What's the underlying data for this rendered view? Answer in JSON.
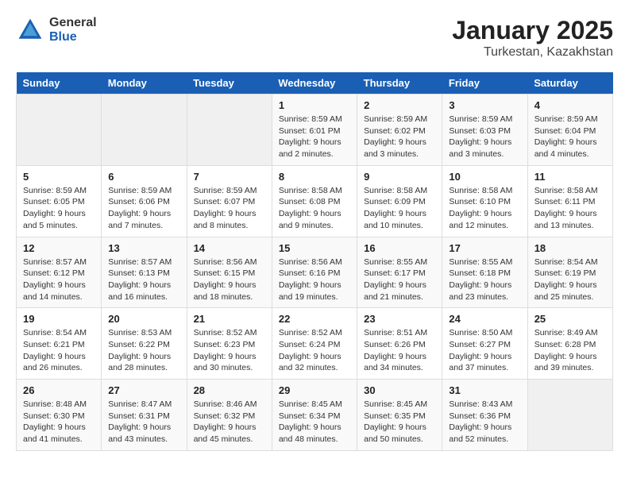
{
  "logo": {
    "general": "General",
    "blue": "Blue"
  },
  "title": "January 2025",
  "subtitle": "Turkestan, Kazakhstan",
  "days_of_week": [
    "Sunday",
    "Monday",
    "Tuesday",
    "Wednesday",
    "Thursday",
    "Friday",
    "Saturday"
  ],
  "weeks": [
    [
      {
        "day": "",
        "info": ""
      },
      {
        "day": "",
        "info": ""
      },
      {
        "day": "",
        "info": ""
      },
      {
        "day": "1",
        "info": "Sunrise: 8:59 AM\nSunset: 6:01 PM\nDaylight: 9 hours\nand 2 minutes."
      },
      {
        "day": "2",
        "info": "Sunrise: 8:59 AM\nSunset: 6:02 PM\nDaylight: 9 hours\nand 3 minutes."
      },
      {
        "day": "3",
        "info": "Sunrise: 8:59 AM\nSunset: 6:03 PM\nDaylight: 9 hours\nand 3 minutes."
      },
      {
        "day": "4",
        "info": "Sunrise: 8:59 AM\nSunset: 6:04 PM\nDaylight: 9 hours\nand 4 minutes."
      }
    ],
    [
      {
        "day": "5",
        "info": "Sunrise: 8:59 AM\nSunset: 6:05 PM\nDaylight: 9 hours\nand 5 minutes."
      },
      {
        "day": "6",
        "info": "Sunrise: 8:59 AM\nSunset: 6:06 PM\nDaylight: 9 hours\nand 7 minutes."
      },
      {
        "day": "7",
        "info": "Sunrise: 8:59 AM\nSunset: 6:07 PM\nDaylight: 9 hours\nand 8 minutes."
      },
      {
        "day": "8",
        "info": "Sunrise: 8:58 AM\nSunset: 6:08 PM\nDaylight: 9 hours\nand 9 minutes."
      },
      {
        "day": "9",
        "info": "Sunrise: 8:58 AM\nSunset: 6:09 PM\nDaylight: 9 hours\nand 10 minutes."
      },
      {
        "day": "10",
        "info": "Sunrise: 8:58 AM\nSunset: 6:10 PM\nDaylight: 9 hours\nand 12 minutes."
      },
      {
        "day": "11",
        "info": "Sunrise: 8:58 AM\nSunset: 6:11 PM\nDaylight: 9 hours\nand 13 minutes."
      }
    ],
    [
      {
        "day": "12",
        "info": "Sunrise: 8:57 AM\nSunset: 6:12 PM\nDaylight: 9 hours\nand 14 minutes."
      },
      {
        "day": "13",
        "info": "Sunrise: 8:57 AM\nSunset: 6:13 PM\nDaylight: 9 hours\nand 16 minutes."
      },
      {
        "day": "14",
        "info": "Sunrise: 8:56 AM\nSunset: 6:15 PM\nDaylight: 9 hours\nand 18 minutes."
      },
      {
        "day": "15",
        "info": "Sunrise: 8:56 AM\nSunset: 6:16 PM\nDaylight: 9 hours\nand 19 minutes."
      },
      {
        "day": "16",
        "info": "Sunrise: 8:55 AM\nSunset: 6:17 PM\nDaylight: 9 hours\nand 21 minutes."
      },
      {
        "day": "17",
        "info": "Sunrise: 8:55 AM\nSunset: 6:18 PM\nDaylight: 9 hours\nand 23 minutes."
      },
      {
        "day": "18",
        "info": "Sunrise: 8:54 AM\nSunset: 6:19 PM\nDaylight: 9 hours\nand 25 minutes."
      }
    ],
    [
      {
        "day": "19",
        "info": "Sunrise: 8:54 AM\nSunset: 6:21 PM\nDaylight: 9 hours\nand 26 minutes."
      },
      {
        "day": "20",
        "info": "Sunrise: 8:53 AM\nSunset: 6:22 PM\nDaylight: 9 hours\nand 28 minutes."
      },
      {
        "day": "21",
        "info": "Sunrise: 8:52 AM\nSunset: 6:23 PM\nDaylight: 9 hours\nand 30 minutes."
      },
      {
        "day": "22",
        "info": "Sunrise: 8:52 AM\nSunset: 6:24 PM\nDaylight: 9 hours\nand 32 minutes."
      },
      {
        "day": "23",
        "info": "Sunrise: 8:51 AM\nSunset: 6:26 PM\nDaylight: 9 hours\nand 34 minutes."
      },
      {
        "day": "24",
        "info": "Sunrise: 8:50 AM\nSunset: 6:27 PM\nDaylight: 9 hours\nand 37 minutes."
      },
      {
        "day": "25",
        "info": "Sunrise: 8:49 AM\nSunset: 6:28 PM\nDaylight: 9 hours\nand 39 minutes."
      }
    ],
    [
      {
        "day": "26",
        "info": "Sunrise: 8:48 AM\nSunset: 6:30 PM\nDaylight: 9 hours\nand 41 minutes."
      },
      {
        "day": "27",
        "info": "Sunrise: 8:47 AM\nSunset: 6:31 PM\nDaylight: 9 hours\nand 43 minutes."
      },
      {
        "day": "28",
        "info": "Sunrise: 8:46 AM\nSunset: 6:32 PM\nDaylight: 9 hours\nand 45 minutes."
      },
      {
        "day": "29",
        "info": "Sunrise: 8:45 AM\nSunset: 6:34 PM\nDaylight: 9 hours\nand 48 minutes."
      },
      {
        "day": "30",
        "info": "Sunrise: 8:45 AM\nSunset: 6:35 PM\nDaylight: 9 hours\nand 50 minutes."
      },
      {
        "day": "31",
        "info": "Sunrise: 8:43 AM\nSunset: 6:36 PM\nDaylight: 9 hours\nand 52 minutes."
      },
      {
        "day": "",
        "info": ""
      }
    ]
  ]
}
